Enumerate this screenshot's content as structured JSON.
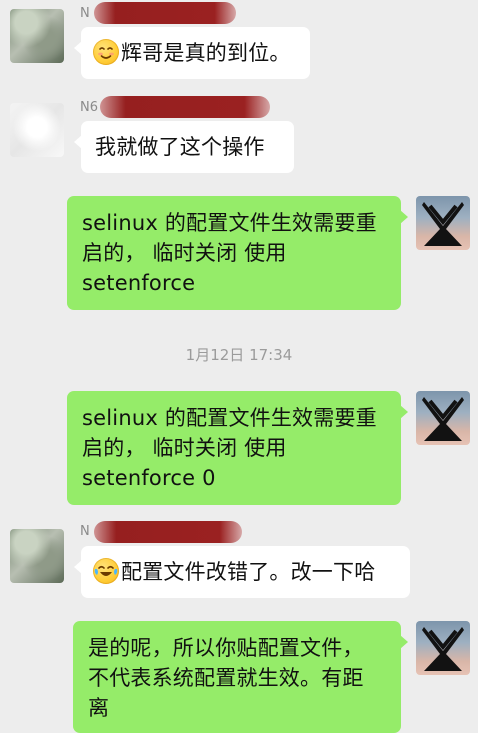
{
  "messages": {
    "m1": {
      "sender_prefix": "N",
      "text": "辉哥是真的到位。",
      "emoji": "smile-blush-emoji"
    },
    "m2": {
      "sender_prefix": "N6",
      "text": "我就做了这个操作"
    },
    "m3": {
      "text_line1": "selinux 的配置文件生效需要重",
      "text_line2": "启的， 临时关闭 使用",
      "text_line3": "setenforce"
    },
    "timestamp": "1月12日 17:34",
    "m4": {
      "text_line1": "selinux 的配置文件生效需要重",
      "text_line2": "启的， 临时关闭 使用",
      "text_line3": "setenforce 0"
    },
    "m5": {
      "sender_prefix": "N",
      "text": "配置文件改错了。改一下哈",
      "emoji": "tears-of-joy-emoji"
    },
    "m6": {
      "text_line1": "是的呢，所以你贴配置文件，",
      "text_line2": "不代表系统配置就生效。有距",
      "text_line3": "离"
    }
  },
  "colors": {
    "background": "#ededed",
    "incoming_bubble": "#ffffff",
    "outgoing_bubble": "#95ec69",
    "name_text": "#8a8a8a",
    "timestamp_text": "#9b9b9b"
  }
}
